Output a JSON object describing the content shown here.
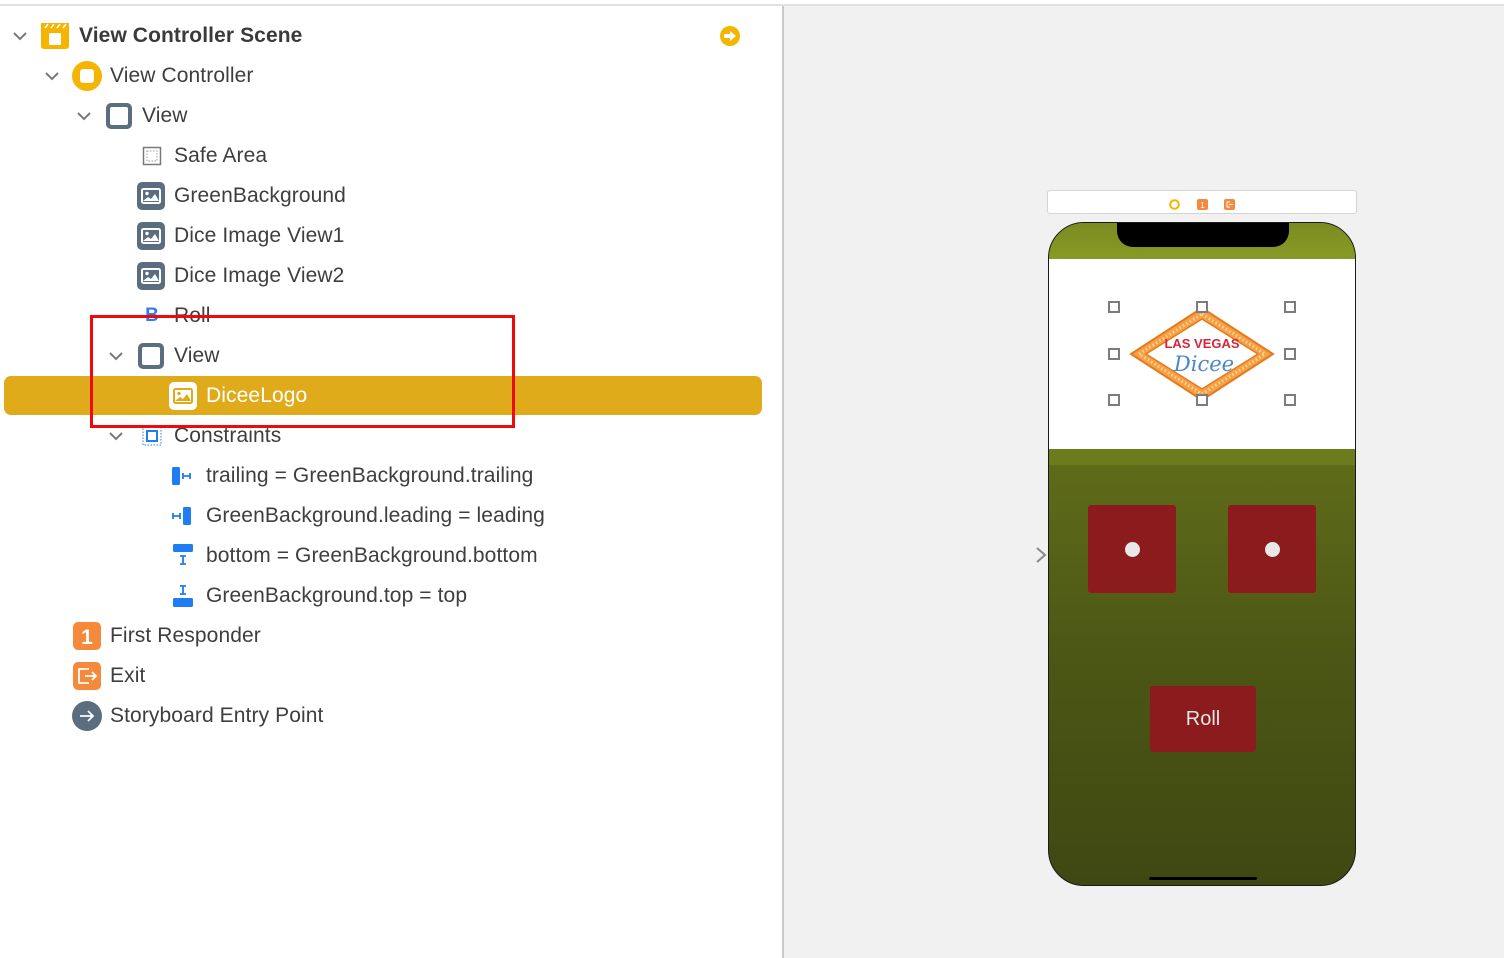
{
  "outline": {
    "scene": {
      "label": "View Controller Scene",
      "go_icon": "arrow-right-circle-icon"
    },
    "items": [
      {
        "label": "View Controller Scene",
        "icon": "scene-icon",
        "expanded": true,
        "bold": true
      },
      {
        "label": "View Controller",
        "icon": "view-controller-icon",
        "expanded": true
      },
      {
        "label": "View",
        "icon": "view-icon",
        "expanded": true
      },
      {
        "label": "Safe Area",
        "icon": "safe-area-icon"
      },
      {
        "label": "GreenBackground",
        "icon": "image-view-icon"
      },
      {
        "label": "Dice Image View1",
        "icon": "image-view-icon"
      },
      {
        "label": "Dice Image View2",
        "icon": "image-view-icon"
      },
      {
        "label": "Roll",
        "icon": "button-icon"
      },
      {
        "label": "View",
        "icon": "view-icon",
        "expanded": true
      },
      {
        "label": "DiceeLogo",
        "icon": "image-view-icon",
        "selected": true
      },
      {
        "label": "Constraints",
        "icon": "constraints-icon",
        "expanded": true
      },
      {
        "label": "trailing = GreenBackground.trailing",
        "icon": "trailing-constraint-icon"
      },
      {
        "label": "GreenBackground.leading = leading",
        "icon": "leading-constraint-icon"
      },
      {
        "label": "bottom = GreenBackground.bottom",
        "icon": "bottom-constraint-icon"
      },
      {
        "label": "GreenBackground.top = top",
        "icon": "top-constraint-icon"
      },
      {
        "label": "First Responder",
        "icon": "first-responder-icon",
        "glyph": "1"
      },
      {
        "label": "Exit",
        "icon": "exit-icon"
      },
      {
        "label": "Storyboard Entry Point",
        "icon": "entry-point-icon"
      }
    ]
  },
  "canvas": {
    "scene_bar_icons": [
      "view-controller-icon",
      "first-responder-icon",
      "exit-icon"
    ],
    "first_responder_glyph": "1",
    "logo": {
      "line1": "LAS VEGAS",
      "line2": "Dicee"
    },
    "roll_button": "Roll",
    "dice": [
      {
        "value": 1
      },
      {
        "value": 1
      }
    ]
  },
  "colors": {
    "selection": "#e0ab1b",
    "highlight_box": "#ee0a0a",
    "dice_red": "#8b1b1d",
    "felt_green": "#5f6c19",
    "orange": "#f58a3d",
    "constraint_blue": "#1f7cf5"
  }
}
